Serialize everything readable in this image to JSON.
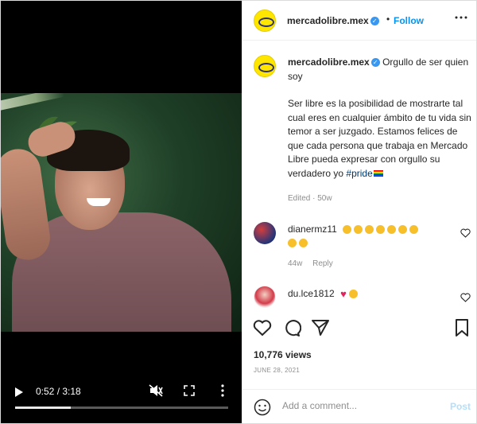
{
  "video": {
    "time": "0:52 / 3:18",
    "progress": 0.26
  },
  "header": {
    "username": "mercadolibre.mex",
    "dot": "•",
    "follow_label": "Follow"
  },
  "caption": {
    "username": "mercadolibre.mex",
    "lead": "Orgullo de ser quien soy",
    "body": "Ser libre es la posibilidad de mostrarte tal cual eres en cualquier ámbito de tu vida sin temor a ser juzgado. Estamos felices de que cada persona que trabaja en Mercado Libre pueda expresar con orgullo su verdadero yo",
    "hashtag": "#pride",
    "edited": "Edited · 50w"
  },
  "comments": [
    {
      "username": "dianermz11",
      "time": "44w",
      "reply_label": "Reply"
    },
    {
      "username": "du.lce1812"
    }
  ],
  "stats": {
    "views": "10,776 views",
    "date": "JUNE 28, 2021"
  },
  "composer": {
    "placeholder": "Add a comment...",
    "post_label": "Post"
  },
  "colors": {
    "accent": "#0095f6",
    "verified": "#3897f0",
    "brand_yellow": "#ffe600"
  },
  "icons": [
    "play-icon",
    "mute-icon",
    "fullscreen-icon",
    "more-icon",
    "verified-icon",
    "heart-icon",
    "comment-icon",
    "share-icon",
    "bookmark-icon",
    "smiley-icon"
  ]
}
